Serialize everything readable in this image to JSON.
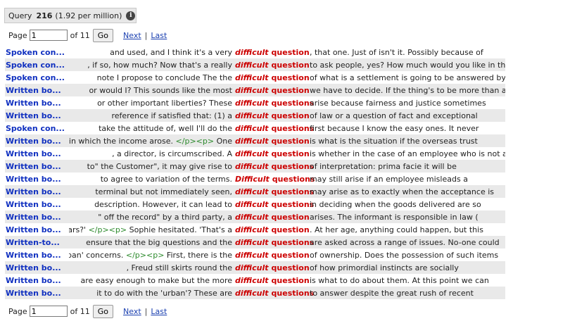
{
  "query": {
    "label": "Query",
    "count": "216",
    "per_million": "(1.92 per million)",
    "info_icon": "info-circle-icon"
  },
  "pager": {
    "page_label": "Page",
    "page_value": "1",
    "of_label": "of 11",
    "go_label": "Go",
    "next_label": "Next",
    "sep": "|",
    "last_label": "Last"
  },
  "rows": [
    {
      "source": "Spoken con...",
      "left": "and used, and I think it's a very",
      "node1": "difficult",
      "node2": "question",
      "right": ", that one. Just of isn't it. Possibly because of"
    },
    {
      "source": "Spoken con...",
      "left": ", if so, how much? Now that's a really",
      "node1": "difficult",
      "node2": "question",
      "right": "to ask people, yes? How much would you like in the"
    },
    {
      "source": "Spoken con...",
      "left": "note I propose to conclude The the",
      "node1": "difficult",
      "node2": "question",
      "right": "of what is a settlement is going to be answered by"
    },
    {
      "source": "Written bo...",
      "left": "or would I? This sounds like the most",
      "node1": "difficult",
      "node2": "question",
      "right": "we have to decide. If the thing's to be more than a"
    },
    {
      "source": "Written bo...",
      "left": "or other important liberties? These",
      "node1": "difficult",
      "node2": "questions",
      "right": "arise because fairness and justice sometimes"
    },
    {
      "source": "Written bo...",
      "left": "reference if satisfied that: (1) a",
      "node1": "difficult",
      "node2": "question",
      "right": "of law or a question of fact and exceptional"
    },
    {
      "source": "Spoken con...",
      "left": "take the attitude of, well I'll do the",
      "node1": "difficult",
      "node2": "questions",
      "right": "first because I know the easy ones. It never"
    },
    {
      "source": "Written bo...",
      "left": "in which the income arose. ",
      "lefttag": "</p><p>",
      "leftafter": " One",
      "node1": "difficult",
      "node2": "question",
      "right": "is what is the situation if the overseas trust"
    },
    {
      "source": "Written bo...",
      "left": ", a director, is circumscribed. A",
      "node1": "difficult",
      "node2": "question",
      "right": "is whether in the case of an employee who is not a"
    },
    {
      "source": "Written bo...",
      "left": "to\" the Customer\", it may give rise to",
      "node1": "difficult",
      "node2": "questions",
      "right": "of interpretation: prima facie it will be"
    },
    {
      "source": "Written bo...",
      "left": "to agree to variation of the terms.",
      "node1": "Difficult",
      "node2": "questions",
      "right": "may still arise if an employee misleads a"
    },
    {
      "source": "Written bo...",
      "left": "terminal but not immediately seen,",
      "node1": "difficult",
      "node2": "questions",
      "right": "may arise as to exactly when the acceptance is"
    },
    {
      "source": "Written bo...",
      "left": "description. However, it can lead to",
      "node1": "difficult",
      "node2": "questions",
      "right": "in deciding when the goods delivered are so"
    },
    {
      "source": "Written bo...",
      "left": "\" off the record\" by a third party, a",
      "node1": "difficult",
      "node2": "question",
      "right": "arises. The informant is responsible in law ("
    },
    {
      "source": "Written bo...",
      "left": "years?' ",
      "lefttag": "</p><p>",
      "leftafter": " Sophie hesitated. 'That's a",
      "node1": "difficult",
      "node2": "question",
      "right": ". At her age, anything could happen, but this"
    },
    {
      "source": "Written-to...",
      "left": "ensure that the big questions and the",
      "node1": "difficult",
      "node2": "questions",
      "right": "are asked across a range of issues. No-one could"
    },
    {
      "source": "Written bo...",
      "left": "urban' concerns. ",
      "lefttag": "</p><p>",
      "leftafter": " First, there is the",
      "node1": "difficult",
      "node2": "question",
      "right": "of ownership. Does the possession of such items"
    },
    {
      "source": "Written bo...",
      "left": ", Freud still skirts round the",
      "node1": "difficult",
      "node2": "question",
      "right": "of how primordial instincts are socially"
    },
    {
      "source": "Written bo...",
      "left": "are easy enough to make but the more",
      "node1": "difficult",
      "node2": "question",
      "right": "is what to do about them. At this point we can"
    },
    {
      "source": "Written bo...",
      "left": "it to do with the 'urban'? These are",
      "node1": "difficult",
      "node2": "questions",
      "right": "to answer despite the great rush of recent"
    }
  ]
}
